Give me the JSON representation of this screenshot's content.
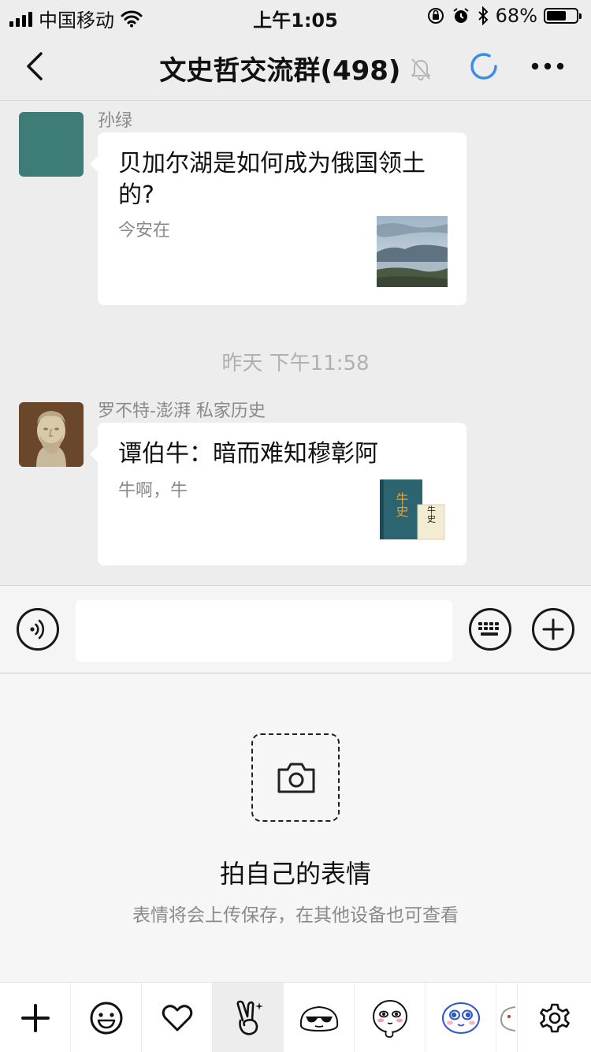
{
  "status_bar": {
    "carrier": "中国移动",
    "time": "上午1:05",
    "battery_percent": "68%",
    "battery_level": 0.68
  },
  "nav": {
    "title": "文史哲交流群(498)",
    "back_icon": "chevron-left-icon",
    "mute_icon": "bell-slash-icon",
    "loading_icon": "spinner-icon",
    "more_icon": "ellipsis-icon"
  },
  "messages": [
    {
      "sender": "孙绿",
      "title": "贝加尔湖是如何成为俄国领土的?",
      "desc": "今安在",
      "avatar_color": "#3d7c77"
    },
    {
      "sender": "罗不特-澎湃 私家历史",
      "title": "谭伯牛：暗而难知穆彰阿",
      "desc": "牛啊，牛",
      "thumb_text_1": "牛史",
      "thumb_text_2": "牛史"
    }
  ],
  "timestamp": "昨天 下午11:58",
  "input_bar": {
    "voice_icon": "voice-icon",
    "keyboard_icon": "keyboard-icon",
    "add_icon": "plus-circle-icon",
    "input_value": ""
  },
  "sticker_panel": {
    "camera_icon": "camera-icon",
    "title": "拍自己的表情",
    "subtitle": "表情将会上传保存，在其他设备也可查看"
  },
  "tabs": [
    {
      "icon": "plus-icon"
    },
    {
      "icon": "smiley-icon"
    },
    {
      "icon": "heart-icon"
    },
    {
      "icon": "victory-hand-icon",
      "selected": true
    },
    {
      "icon": "sunglasses-face-icon"
    },
    {
      "icon": "blush-face-icon"
    },
    {
      "icon": "blue-eyes-face-icon"
    },
    {
      "icon": "gear-icon"
    }
  ],
  "colors": {
    "background": "#ededed",
    "card": "#ffffff",
    "loading_blue": "#3a8ee6"
  }
}
